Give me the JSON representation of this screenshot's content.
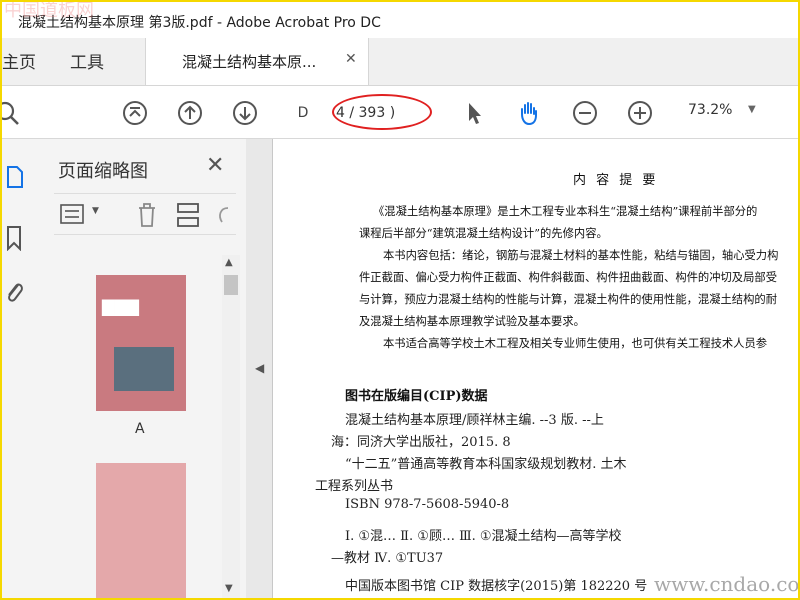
{
  "window": {
    "title": "混凝土结构基本原理 第3版.pdf - Adobe Acrobat Pro DC"
  },
  "tabs": {
    "home": "主页",
    "tools": "工具",
    "document": "混凝土结构基本原...",
    "close": "✕"
  },
  "toolbar": {
    "page_field": "D",
    "page_count": "4 / 393 )",
    "zoom": "73.2%"
  },
  "thumbnail_panel": {
    "title": "页面缩略图",
    "thumb_label": "A"
  },
  "document": {
    "heading": "内 容 提 要",
    "summary_lines": [
      "《混凝土结构基本原理》是土木工程专业本科生“混凝土结构”课程前半部分的",
      "课程后半部分“建筑混凝土结构设计”的先修内容。",
      "本书内容包括：绪论，钢筋与混凝土材料的基本性能，粘结与锚固，轴心受力构",
      "件正截面、偏心受力构件正截面、构件斜截面、构件扭曲截面、构件的冲切及局部受",
      "与计算，预应力混凝土结构的性能与计算，混凝土构件的使用性能，混凝土结构的耐",
      "及混凝土结构基本原理教学试验及基本要求。",
      "本书适合高等学校土木工程及相关专业师生使用，也可供有关工程技术人员参"
    ],
    "cip_title": "图书在版编目(CIP)数据",
    "cip_lines": [
      "混凝土结构基本原理/顾祥林主编. --3 版. --上",
      "海：同济大学出版社，2015. 8",
      "“十二五”普通高等教育本科国家级规划教材. 土木",
      "工程系列丛书",
      "ISBN 978-7-5608-5940-8",
      "Ⅰ. ①混…    Ⅱ. ①顾…    Ⅲ. ①混凝土结构—高等学校",
      "—教材    Ⅳ. ①TU37",
      "中国版本图书馆 CIP 数据核字(2015)第 182220 号"
    ]
  },
  "watermarks": {
    "top_left": "中国道板网",
    "bottom_right": "www.cndao.com"
  },
  "colors": {
    "accent": "#1473e6",
    "highlight": "#e02020",
    "frame": "#f5d800"
  }
}
